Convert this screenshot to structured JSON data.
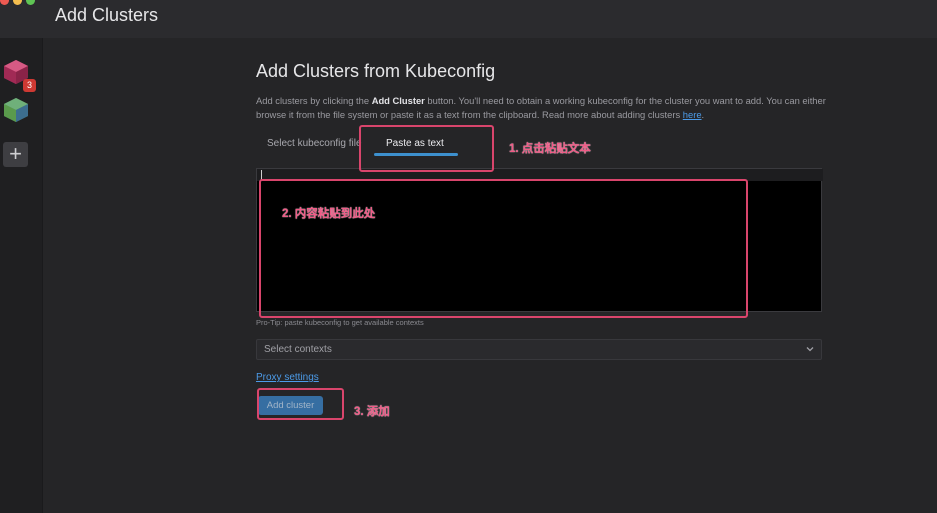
{
  "window": {
    "title": "Add Clusters"
  },
  "hotbar": {
    "badge_count": "3",
    "add_label": "+"
  },
  "main": {
    "heading": "Add Clusters from Kubeconfig",
    "desc_part1": "Add clusters by clicking the ",
    "desc_bold": "Add Cluster",
    "desc_part2": " button. You'll need to obtain a working kubeconfig for the cluster you want to add. You can either browse it from the file system or paste it as a text from the clipboard. Read more about adding clusters ",
    "desc_link": "here",
    "desc_end": ".",
    "tabs": [
      {
        "label": "Select kubeconfig file",
        "active": false
      },
      {
        "label": "Paste as text",
        "active": true
      }
    ],
    "protip": "Pro-Tip: paste kubeconfig to get available contexts",
    "contexts_placeholder": "Select contexts",
    "proxy_link": "Proxy settings",
    "add_button": "Add cluster"
  },
  "annotations": [
    {
      "label": "1. 点击粘贴文本"
    },
    {
      "label": "2. 内容粘贴到此处"
    },
    {
      "label": "3. 添加"
    }
  ],
  "colors": {
    "accent": "#3d90ce",
    "link": "#4c9be8",
    "annotation": "#d9456c",
    "badge": "#ce3933"
  },
  "icons": [
    "cluster-icon",
    "cluster-icon",
    "plus-icon",
    "chevron-down-icon"
  ]
}
